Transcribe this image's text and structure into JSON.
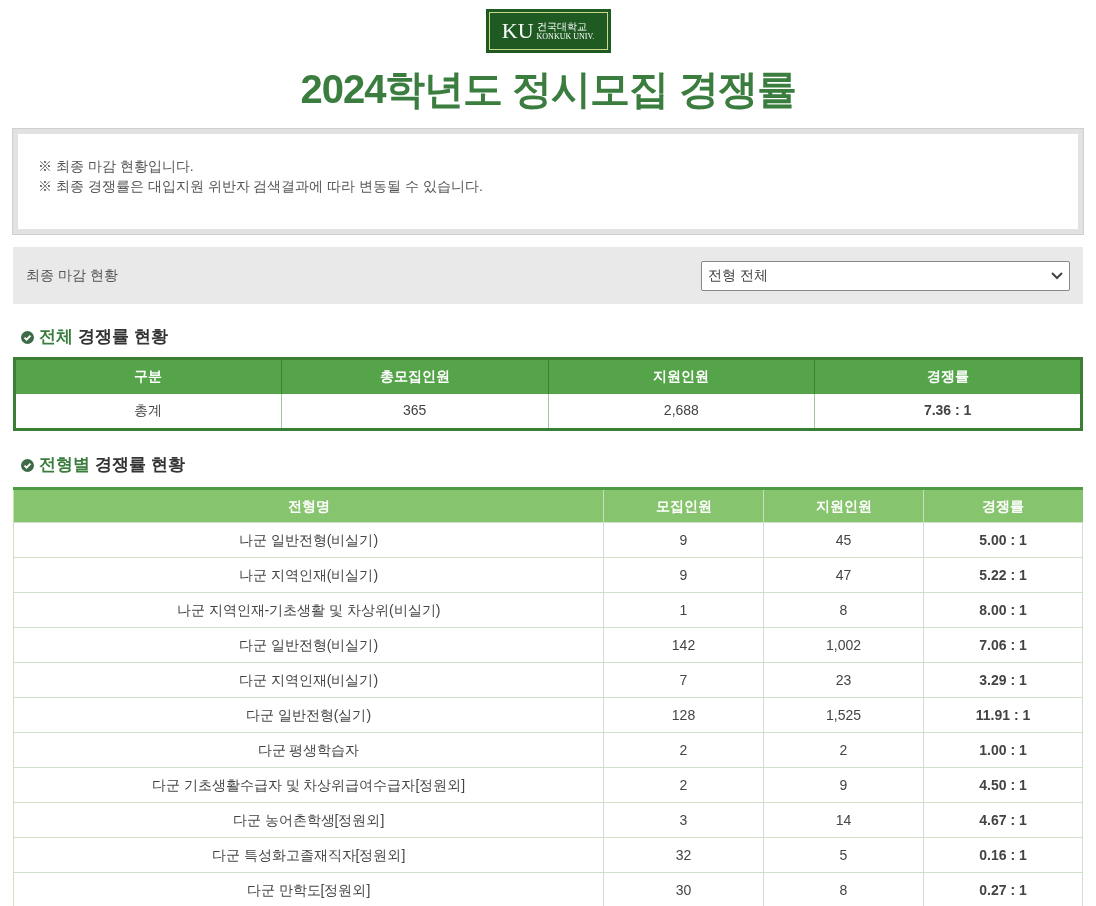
{
  "logo": {
    "mark": "KU",
    "name": "건국대학교",
    "english": "KONKUK UNIV."
  },
  "title": "2024학년도 정시모집 경쟁률",
  "notices": [
    "※ 최종 마감 현황입니다.",
    "※ 최종 경쟁률은 대입지원 위반자 검색결과에 따라 변동될 수 있습니다."
  ],
  "filter": {
    "label": "최종 마감 현황",
    "select_value": "전형 전체"
  },
  "total_section": {
    "heading_highlight": "전체",
    "heading_rest": "경쟁률 현황",
    "columns": [
      "구분",
      "총모집인원",
      "지원인원",
      "경쟁률"
    ],
    "rows": [
      [
        "총계",
        "365",
        "2,688",
        "7.36 : 1"
      ]
    ]
  },
  "type_section": {
    "heading_highlight": "전형별",
    "heading_rest": "경쟁률 현황",
    "columns": [
      "전형명",
      "모집인원",
      "지원인원",
      "경쟁률"
    ],
    "rows": [
      [
        "나군 일반전형(비실기)",
        "9",
        "45",
        "5.00 : 1"
      ],
      [
        "나군 지역인재(비실기)",
        "9",
        "47",
        "5.22 : 1"
      ],
      [
        "나군 지역인재-기초생활 및 차상위(비실기)",
        "1",
        "8",
        "8.00 : 1"
      ],
      [
        "다군 일반전형(비실기)",
        "142",
        "1,002",
        "7.06 : 1"
      ],
      [
        "다군 지역인재(비실기)",
        "7",
        "23",
        "3.29 : 1"
      ],
      [
        "다군 일반전형(실기)",
        "128",
        "1,525",
        "11.91 : 1"
      ],
      [
        "다군 평생학습자",
        "2",
        "2",
        "1.00 : 1"
      ],
      [
        "다군 기초생활수급자 및 차상위급여수급자[정원외]",
        "2",
        "9",
        "4.50 : 1"
      ],
      [
        "다군 농어촌학생[정원외]",
        "3",
        "14",
        "4.67 : 1"
      ],
      [
        "다군 특성화고졸재직자[정원외]",
        "32",
        "5",
        "0.16 : 1"
      ],
      [
        "다군 만학도[정원외]",
        "30",
        "8",
        "0.27 : 1"
      ]
    ]
  }
}
